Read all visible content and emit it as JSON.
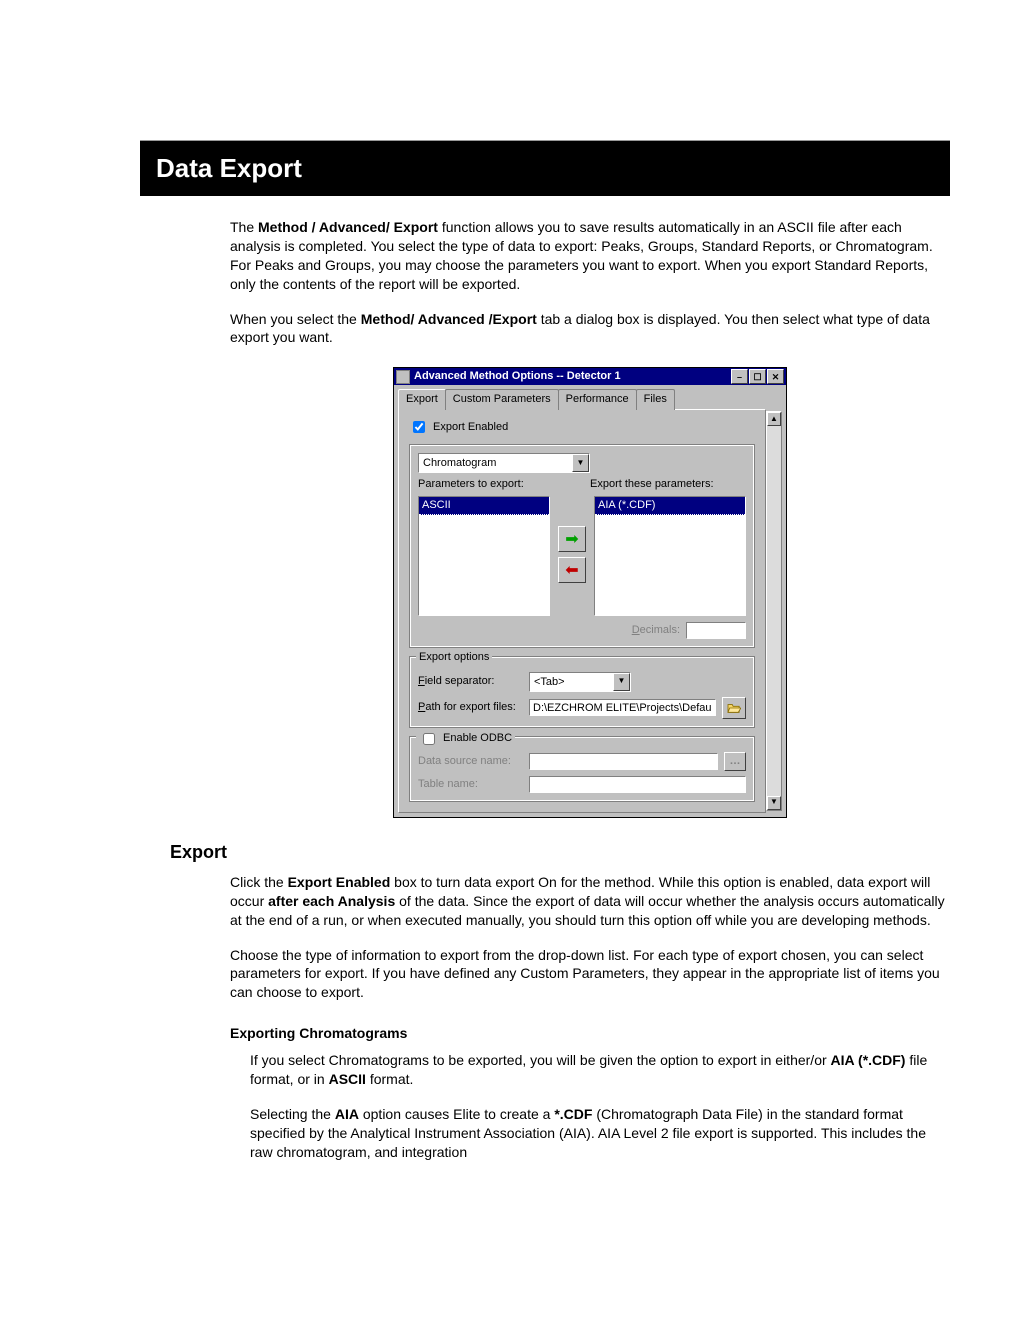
{
  "title": "Data Export",
  "intro": {
    "p1a": "The ",
    "p1b": "Method / Advanced/ Export",
    "p1c": " function allows you to save results automatically in an ASCII file after each analysis is completed. You select the type of data to export: Peaks, Groups, Standard Reports, or Chromatogram. For Peaks and Groups, you may choose the parameters you want to export.  When you export Standard Reports, only the contents of the report will be exported.",
    "p2a": "When you select the ",
    "p2b": "Method/ Advanced /Export",
    "p2c": " tab a dialog box is displayed. You then select what type of data export you want."
  },
  "dialog": {
    "window_title": "Advanced Method Options -- Detector 1",
    "min_glyph": "–",
    "max_glyph": "☐",
    "close_glyph": "✕",
    "tabs": [
      "Export",
      "Custom Parameters",
      "Performance",
      "Files"
    ],
    "export_enabled_label": "Export Enabled",
    "export_enabled_checked": true,
    "type_dropdown_value": "Chromatogram",
    "params_label": "Parameters to export:",
    "export_these_label": "Export these parameters:",
    "left_list_item": "ASCII",
    "right_list_item": "AIA (*.CDF)",
    "decimals_label": "Decimals:",
    "decimals_value": "",
    "export_options_title": "Export options",
    "field_sep_label": "Field separator:",
    "field_sep_letter": "F",
    "field_sep_value": "<Tab>",
    "path_label": "Path for export files:",
    "path_letter": "P",
    "path_value": "D:\\EZCHROM ELITE\\Projects\\Default\\Data\\Expor",
    "enable_odbc_label": "Enable ODBC",
    "data_source_label": "Data source name:",
    "table_name_label": "Table name:"
  },
  "section_export": {
    "heading": "Export",
    "p1a": "Click the ",
    "p1b": "Export Enabled",
    "p1c": " box to turn data export On for the method. While this option is enabled, data export will occur ",
    "p1d": "after each Analysis",
    "p1e": " of the data.  Since the export of data will occur whether the analysis occurs automatically at the end of a run, or when executed manually, you should turn this option off while you are developing methods.",
    "p2": "Choose the type of information to export from the drop-down list.  For each type of export chosen, you can select parameters for export. If you have defined any Custom Parameters, they appear in the appropriate list of items you can choose to export.",
    "sub_heading": "Exporting Chromatograms",
    "sp1a": "If you select Chromatograms to be exported, you will be given the option to export in either/or ",
    "sp1b": "AIA (*.CDF)",
    "sp1c": " file format, or in ",
    "sp1d": "ASCII",
    "sp1e": " format.",
    "sp2a": "Selecting the ",
    "sp2b": "AIA",
    "sp2c": " option causes Elite to create a ",
    "sp2d": "*.CDF",
    "sp2e": " (Chromatograph Data File) in the standard format specified by the Analytical Instrument Association (AIA).  AIA Level 2 file export is supported. This includes the raw chromatogram, and integration"
  }
}
